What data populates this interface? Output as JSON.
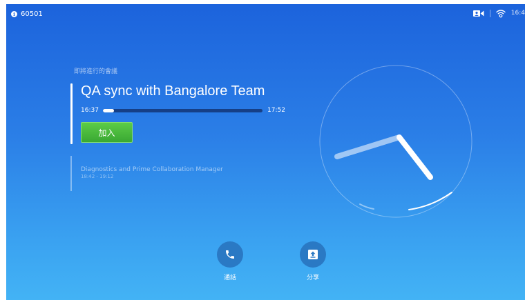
{
  "status_bar": {
    "info_icon": "info-icon",
    "info_glyph": "i",
    "system_id": "60501",
    "camera_icon": "camera-icon",
    "wifi_icon": "wifi-icon",
    "clock": "16:4"
  },
  "meeting": {
    "upcoming_label": "即將進行的會議",
    "title": "QA sync with Bangalore Team",
    "start_time": "16:37",
    "end_time": "17:52",
    "progress": 0.07,
    "join_label": "加入"
  },
  "next_meeting": {
    "title": "Diagnostics and Prime Collaboration Manager",
    "time": "18:42 - 19:12"
  },
  "actions": {
    "call_label": "通話",
    "call_icon": "phone-icon",
    "share_label": "分享",
    "share_icon": "share-upload-icon"
  },
  "colors": {
    "background_top": "#1c63dc",
    "background_bottom": "#43b3f5",
    "join_button": "#4cbb3f",
    "action_circle": "#2a79c4"
  }
}
